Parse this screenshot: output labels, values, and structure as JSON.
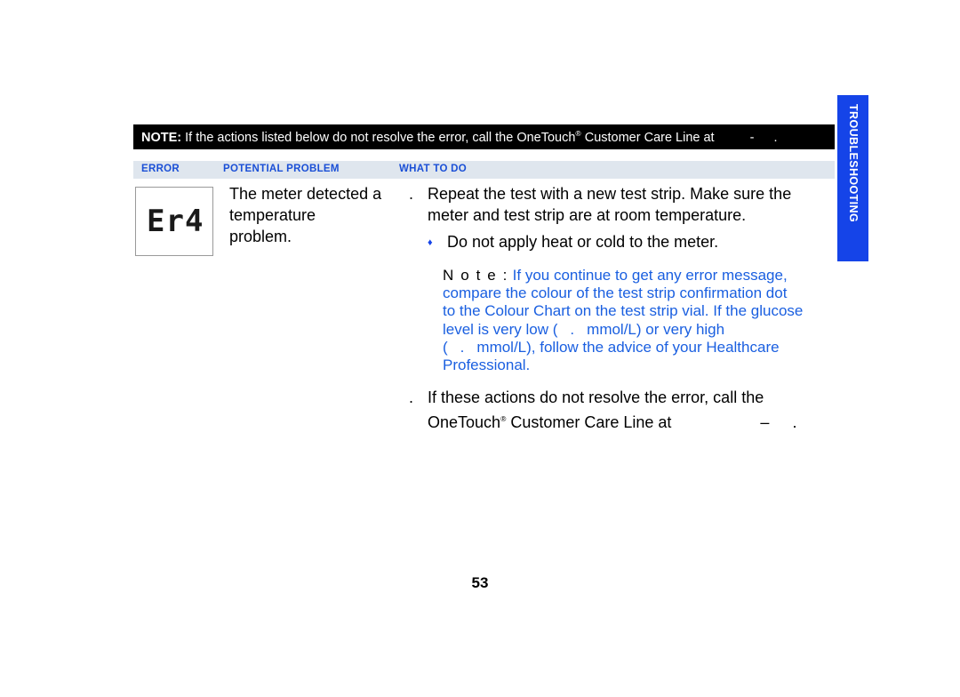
{
  "note_banner": {
    "label": "NOTE:",
    "text_before": " If the actions listed below do not resolve the error, call the OneTouch",
    "registered_mark": "®",
    "text_after": " Customer Care Line at",
    "phone_separator": "-",
    "phone_end": "."
  },
  "column_headers": {
    "error": "ERROR",
    "potential_problem": "POTENTIAL PROBLEM",
    "what_to_do": "WHAT TO DO"
  },
  "side_tab": {
    "label": "TROUBLESHOOTING"
  },
  "error_display": {
    "code": "Er4"
  },
  "potential_problem": {
    "line1": "The meter detected a",
    "line2": "temperature",
    "line3": "problem."
  },
  "what_to_do": {
    "bullet1_marker": ".",
    "bullet1_line1": "Repeat the test with a new test strip. Make sure the",
    "bullet1_line2": "meter and test strip are at room temperature.",
    "bullet2_marker": "♦",
    "bullet2_text": "Do not apply heat or cold to the meter.",
    "note_label": "N o t e :",
    "note_line1": " If you continue to get any error message,",
    "note_line2": "compare the colour of the test strip confirmation dot",
    "note_line3": "to the Colour Chart on the test strip vial. If the glucose",
    "note_line4_a": "level is very low (",
    "note_line4_b": ".",
    "note_line4_c": "mmol/L) or very high",
    "note_line5_a": "(",
    "note_line5_b": ".",
    "note_line5_c": "mmol/L), follow the advice of your Healthcare",
    "note_line6": "Professional.",
    "bullet3_marker": ".",
    "bullet3_line1": "If these actions do not resolve the error, call the",
    "bullet3_line2_a": "OneTouch",
    "bullet3_registered": "®",
    "bullet3_line2_b": " Customer Care Line at",
    "bullet3_dash": "–",
    "bullet3_end": "."
  },
  "page_number": "53",
  "colors": {
    "banner_background": "#000000",
    "banner_text": "#ffffff",
    "header_strip": "#dfe6ee",
    "header_text": "#1a4fd6",
    "side_tab": "#1544e8",
    "note_blue": "#1a5fe0"
  }
}
